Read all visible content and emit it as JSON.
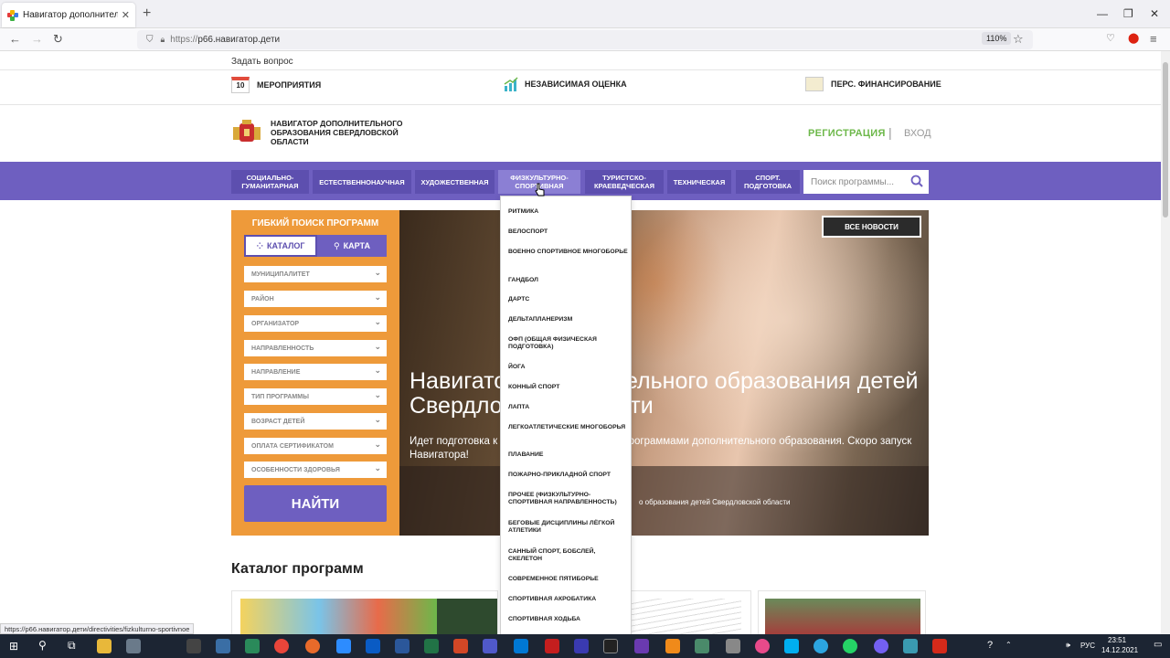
{
  "browser": {
    "tab_title": "Навигатор дополнительного о",
    "tab_close": "✕",
    "new_tab": "+",
    "url_prefix": "https://",
    "url_host": "р66.навигатор.дети",
    "zoom": "110%",
    "status_url": "https://р66.навигатор.дети/directivities/fizkulturno-sportivnoe"
  },
  "topbar": {
    "ask": "Задать вопрос",
    "events_date": "10",
    "events": "МЕРОПРИЯТИЯ",
    "assessment": "НЕЗАВИСИМАЯ ОЦЕНКА",
    "financing": "ПЕРС. ФИНАНСИРОВАНИЕ"
  },
  "header": {
    "logo_text": "НАВИГАТОР ДОПОЛНИТЕЛЬНОГО ОБРАЗОВАНИЯ СВЕРДЛОВСКОЙ ОБЛАСТИ",
    "register": "РЕГИСТРАЦИЯ",
    "separator": "|",
    "login": "ВХОД"
  },
  "nav": {
    "categories": [
      "СОЦИАЛЬНО-ГУМАНИТАРНАЯ",
      "ЕСТЕСТВЕННОНАУЧНАЯ",
      "ХУДОЖЕСТВЕННАЯ",
      "ФИЗКУЛЬТУРНО-СПОРТИВНАЯ",
      "ТУРИСТСКО-КРАЕВЕДЧЕСКАЯ",
      "ТЕХНИЧЕСКАЯ",
      "СПОРТ. ПОДГОТОВКА"
    ],
    "search_placeholder": "Поиск программы..."
  },
  "filters": {
    "title": "ГИБКИЙ ПОИСК ПРОГРАММ",
    "tab_catalog": "КАТАЛОГ",
    "tab_map": "КАРТА",
    "fields": [
      "МУНИЦИПАЛИТЕТ",
      "РАЙОН",
      "ОРГАНИЗАТОР",
      "НАПРАВЛЕННОСТЬ",
      "НАПРАВЛЕНИЕ",
      "ТИП ПРОГРАММЫ",
      "ВОЗРАСТ ДЕТЕЙ",
      "ОПЛАТА СЕРТИФИКАТОМ",
      "ОСОБЕННОСТИ ЗДОРОВЬЯ"
    ],
    "find": "НАЙТИ"
  },
  "hero": {
    "all_news": "ВСЕ НОВОСТИ",
    "heading": "Навигатор дополнительного образования детей Свердловской области",
    "text": "Идет подготовка к наполнению Навигатора программами дополнительного образования. Скоро запуск Навигатора!",
    "caption": "о образования детей Свердловской области"
  },
  "catalog": {
    "title": "Каталог программ"
  },
  "dropdown": {
    "items": [
      "РИТМИКА",
      "ВЕЛОСПОРТ",
      "ВОЕННО СПОРТИВНОЕ МНОГОБОРЬЕ",
      "ГАНДБОЛ",
      "ДАРТС",
      "ДЕЛЬТАПЛАНЕРИЗМ",
      "ОФП (ОБЩАЯ ФИЗИЧЕСКАЯ ПОДГОТОВКА)",
      "ЙОГА",
      "КОННЫЙ СПОРТ",
      "ЛАПТА",
      "ЛЕГКОАТЛЕТИЧЕСКИЕ МНОГОБОРЬЯ",
      "ПЛАВАНИЕ",
      "ПОЖАРНО-ПРИКЛАДНОЙ СПОРТ",
      "ПРОЧЕЕ (ФИЗКУЛЬТУРНО-СПОРТИВНАЯ НАПРАВЛЕННОСТЬ)",
      "БЕГОВЫЕ ДИСЦИПЛИНЫ ЛЁГКОЙ АТЛЕТИКИ",
      "САННЫЙ СПОРТ, БОБСЛЕЙ, СКЕЛЕТОН",
      "СОВРЕМЕННОЕ ПЯТИБОРЬЕ",
      "СПОРТИВНАЯ АКРОБАТИКА",
      "СПОРТИВНАЯ ХОДЬБА"
    ]
  },
  "taskbar": {
    "lang": "РУС",
    "time": "23:51",
    "date": "14.12.2021"
  },
  "colors": {
    "purple": "#6e5fc0",
    "orange": "#ee9a3a",
    "green": "#6db84a"
  }
}
